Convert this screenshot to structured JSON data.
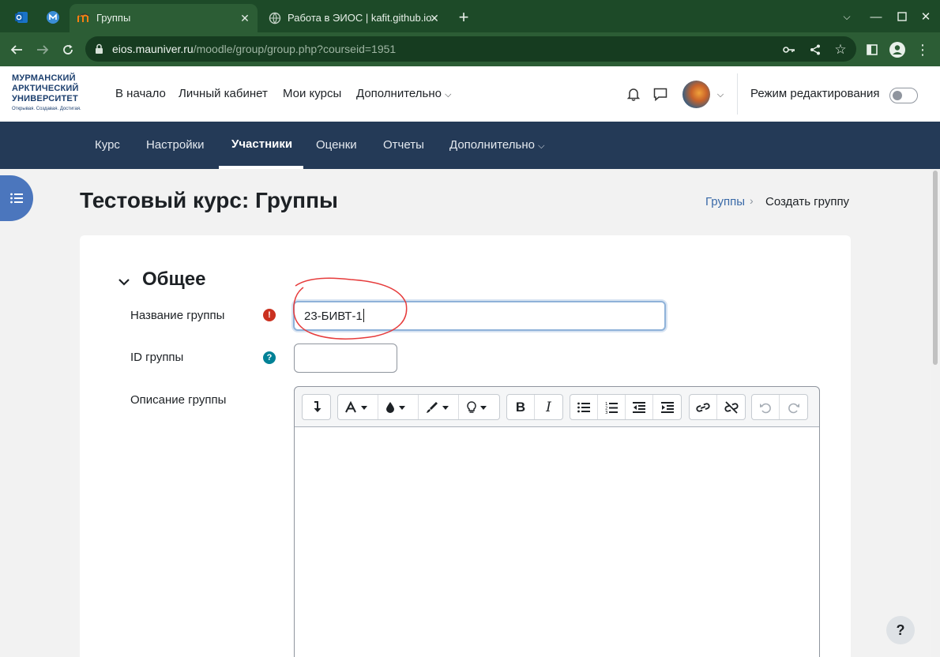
{
  "browser": {
    "tabs": [
      {
        "title": "Группы",
        "active": true,
        "favicon": "moodle-m-icon"
      },
      {
        "title": "Работа в ЭИОС | kafit.github.io",
        "active": false,
        "favicon": "globe-icon"
      }
    ],
    "pinned_tabs": [
      "outlook-icon",
      "mau-app-icon"
    ],
    "url_host": "eios.mauniver.ru",
    "url_path": "/moodle/group/group.php?courseid=1951",
    "colors": {
      "frame": "#1d4a28",
      "toolbar": "#2c5d35"
    }
  },
  "header": {
    "logo_lines": [
      "МУРМАНСКИЙ",
      "АРКТИЧЕСКИЙ",
      "УНИВЕРСИТЕТ"
    ],
    "logo_tagline": "Открывая. Создавая. Достигая.",
    "nav": [
      "В начало",
      "Личный кабинет",
      "Мои курсы",
      "Дополнительно"
    ],
    "edit_mode_label": "Режим редактирования",
    "edit_mode_on": false
  },
  "secondary_nav": {
    "items": [
      "Курс",
      "Настройки",
      "Участники",
      "Оценки",
      "Отчеты",
      "Дополнительно"
    ],
    "active": "Участники",
    "color": "#243a57"
  },
  "page": {
    "title": "Тестовый курс: Группы",
    "breadcrumb": [
      "Группы",
      "Создать группу"
    ]
  },
  "form": {
    "section_title": "Общее",
    "fields": {
      "group_name": {
        "label": "Название группы",
        "value": "23-БИВТ-1",
        "required": true
      },
      "group_id": {
        "label": "ID группы",
        "value": ""
      },
      "description": {
        "label": "Описание группы"
      }
    }
  },
  "editor_toolbar": {
    "groups": [
      [
        "collapse-icon"
      ],
      [
        "font-style-icon",
        "text-color-icon",
        "highlight-icon",
        "accessibility-icon"
      ],
      [
        "bold-icon",
        "italic-icon"
      ],
      [
        "unordered-list-icon",
        "ordered-list-icon",
        "outdent-icon",
        "indent-icon"
      ],
      [
        "link-icon",
        "unlink-icon"
      ],
      [
        "undo-icon",
        "redo-icon"
      ]
    ]
  },
  "help_label": "?"
}
